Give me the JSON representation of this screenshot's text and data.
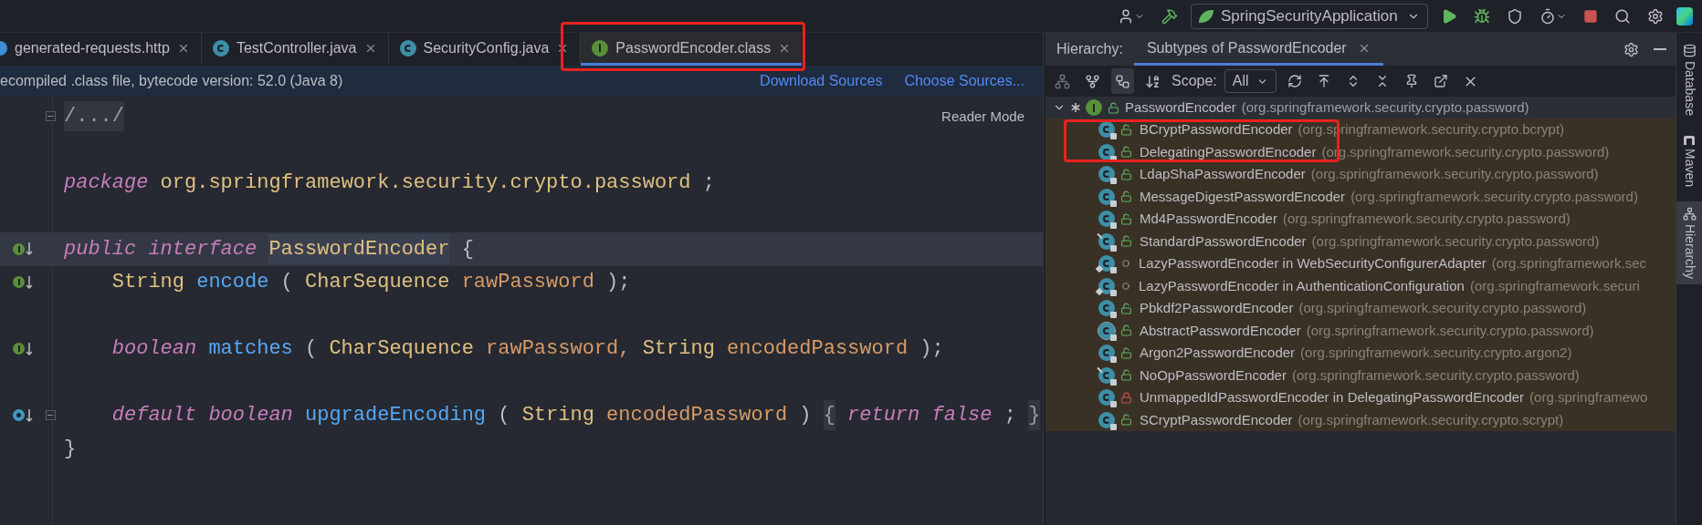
{
  "toolbar": {
    "run_config": "SpringSecurityApplication"
  },
  "editor_tabs": [
    {
      "label": "generated-requests.http",
      "kind": "http",
      "selected": false,
      "highlighted": false
    },
    {
      "label": "TestController.java",
      "kind": "class",
      "selected": false,
      "highlighted": false
    },
    {
      "label": "SecurityConfig.java",
      "kind": "class",
      "selected": false,
      "highlighted": false
    },
    {
      "label": "PasswordEncoder.class",
      "kind": "interface",
      "selected": true,
      "highlighted": true
    }
  ],
  "banner": {
    "text": "ecompiled .class file, bytecode version: 52.0 (Java 8)",
    "links": [
      "Download Sources",
      "Choose Sources..."
    ]
  },
  "editor": {
    "reader_mode": "Reader Mode",
    "lines": [
      {
        "kind": "code",
        "implemented": false,
        "overridden": false,
        "fold": true,
        "current": false,
        "tokens": [
          {
            "kind": "folded",
            "text": "/.../"
          }
        ]
      },
      {
        "kind": "blank",
        "implemented": false,
        "overridden": false,
        "fold": false,
        "current": false
      },
      {
        "kind": "code",
        "implemented": false,
        "overridden": false,
        "fold": false,
        "current": false,
        "tokens": [
          {
            "kind": "keyword",
            "text": "package"
          },
          {
            "kind": "type",
            "text": "org.springframework.security.crypto.password"
          },
          {
            "kind": "plain",
            "text": ";"
          }
        ]
      },
      {
        "kind": "blank",
        "implemented": false,
        "overridden": false,
        "fold": false,
        "current": false
      },
      {
        "kind": "code",
        "implemented": true,
        "overridden": false,
        "fold": false,
        "current": true,
        "tokens": [
          {
            "kind": "keyword",
            "text": "public"
          },
          {
            "kind": "keyword",
            "text": "interface"
          },
          {
            "kind": "highlighted",
            "text": "PasswordEncoder"
          },
          {
            "kind": "plain",
            "text": "{"
          }
        ],
        "children": [
          {
            "kind": "code",
            "implemented": true,
            "overridden": false,
            "fold": false,
            "current": false,
            "tokens": [
              {
                "kind": "type",
                "text": "String"
              },
              {
                "kind": "method",
                "text": "encode"
              },
              {
                "kind": "plain",
                "text": "("
              },
              {
                "kind": "type",
                "text": "CharSequence"
              },
              {
                "kind": "param",
                "text": "rawPassword"
              },
              {
                "kind": "plain",
                "text": ");"
              }
            ]
          },
          {
            "kind": "blank",
            "implemented": false,
            "overridden": false,
            "fold": false,
            "current": false
          },
          {
            "kind": "code",
            "implemented": true,
            "overridden": false,
            "fold": false,
            "current": false,
            "tokens": [
              {
                "kind": "keyword",
                "text": "boolean"
              },
              {
                "kind": "method",
                "text": "matches"
              },
              {
                "kind": "plain",
                "text": "("
              },
              {
                "kind": "type",
                "text": "CharSequence"
              },
              {
                "kind": "param",
                "text": "rawPassword,"
              },
              {
                "kind": "type",
                "text": "String"
              },
              {
                "kind": "param",
                "text": "encodedPassword"
              },
              {
                "kind": "plain",
                "text": ");"
              }
            ]
          },
          {
            "kind": "blank",
            "implemented": false,
            "overridden": false,
            "fold": false,
            "current": false
          },
          {
            "kind": "code",
            "implemented": false,
            "overridden": true,
            "fold": true,
            "current": false,
            "tokens": [
              {
                "kind": "keyword",
                "text": "default"
              },
              {
                "kind": "keyword",
                "text": "boolean"
              },
              {
                "kind": "method",
                "text": "upgradeEncoding"
              },
              {
                "kind": "plain",
                "text": "("
              },
              {
                "kind": "type",
                "text": "String"
              },
              {
                "kind": "param",
                "text": "encodedPassword"
              },
              {
                "kind": "plain",
                "text": ")"
              },
              {
                "kind": "folded",
                "text": "{"
              },
              {
                "kind": "keyword",
                "text": "return"
              },
              {
                "kind": "keyword",
                "text": "false"
              },
              {
                "kind": "plain",
                "text": ";"
              },
              {
                "kind": "folded",
                "text": "}"
              }
            ]
          }
        ]
      },
      {
        "kind": "code",
        "implemented": false,
        "overridden": false,
        "fold": false,
        "current": false,
        "tokens": [
          {
            "kind": "plain",
            "text": "}"
          }
        ]
      }
    ]
  },
  "hierarchy": {
    "label": "Hierarchy:",
    "tab": {
      "label": "Subtypes of PasswordEncoder",
      "selected": true
    },
    "scope_label": "Scope:",
    "scope_value": "All",
    "root": {
      "name": "PasswordEncoder",
      "package": "(org.springframework.security.crypto.password)",
      "expanded": true,
      "children": [
        {
          "name": "BCryptPasswordEncoder",
          "package": "(org.springframework.security.crypto.bcrypt)",
          "kind": "class",
          "public": true,
          "private": false,
          "highlighted": true
        },
        {
          "name": "DelegatingPasswordEncoder",
          "package": "(org.springframework.security.crypto.password)",
          "kind": "class",
          "public": true,
          "private": false,
          "highlighted": true
        },
        {
          "name": "LdapShaPasswordEncoder",
          "package": "(org.springframework.security.crypto.password)",
          "kind": "class",
          "public": true,
          "private": false,
          "highlighted": false
        },
        {
          "name": "MessageDigestPasswordEncoder",
          "package": "(org.springframework.security.crypto.password)",
          "kind": "class",
          "public": true,
          "private": false,
          "highlighted": false
        },
        {
          "name": "Md4PasswordEncoder",
          "package": "(org.springframework.security.crypto.password)",
          "kind": "class",
          "public": true,
          "private": false,
          "highlighted": false
        },
        {
          "name": "StandardPasswordEncoder",
          "package": "(org.springframework.security.crypto.password)",
          "kind": "deprecated",
          "public": true,
          "private": false,
          "highlighted": false
        },
        {
          "name": "LazyPasswordEncoder in WebSecurityConfigurerAdapter",
          "package": "(org.springframework.sec",
          "kind": "inner",
          "public": false,
          "private": false,
          "highlighted": false
        },
        {
          "name": "LazyPasswordEncoder in AuthenticationConfiguration",
          "package": "(org.springframework.securi",
          "kind": "inner",
          "public": false,
          "private": false,
          "highlighted": false
        },
        {
          "name": "Pbkdf2PasswordEncoder",
          "package": "(org.springframework.security.crypto.password)",
          "kind": "class",
          "public": true,
          "private": false,
          "highlighted": false
        },
        {
          "name": "AbstractPasswordEncoder",
          "package": "(org.springframework.security.crypto.password)",
          "kind": "abstract",
          "public": true,
          "private": false,
          "highlighted": false
        },
        {
          "name": "Argon2PasswordEncoder",
          "package": "(org.springframework.security.crypto.argon2)",
          "kind": "class",
          "public": true,
          "private": false,
          "highlighted": false
        },
        {
          "name": "NoOpPasswordEncoder",
          "package": "(org.springframework.security.crypto.password)",
          "kind": "deprecated",
          "public": true,
          "private": false,
          "highlighted": false
        },
        {
          "name": "UnmappedIdPasswordEncoder in DelegatingPasswordEncoder",
          "package": "(org.springframewo",
          "kind": "class",
          "public": false,
          "private": true,
          "highlighted": false
        },
        {
          "name": "SCryptPasswordEncoder",
          "package": "(org.springframework.security.crypto.scrypt)",
          "kind": "class",
          "public": true,
          "private": false,
          "highlighted": false
        }
      ]
    }
  },
  "side_strip": [
    {
      "label": "Database",
      "selected": false
    },
    {
      "label": "Maven",
      "selected": false
    },
    {
      "label": "Hierarchy",
      "selected": true
    }
  ]
}
